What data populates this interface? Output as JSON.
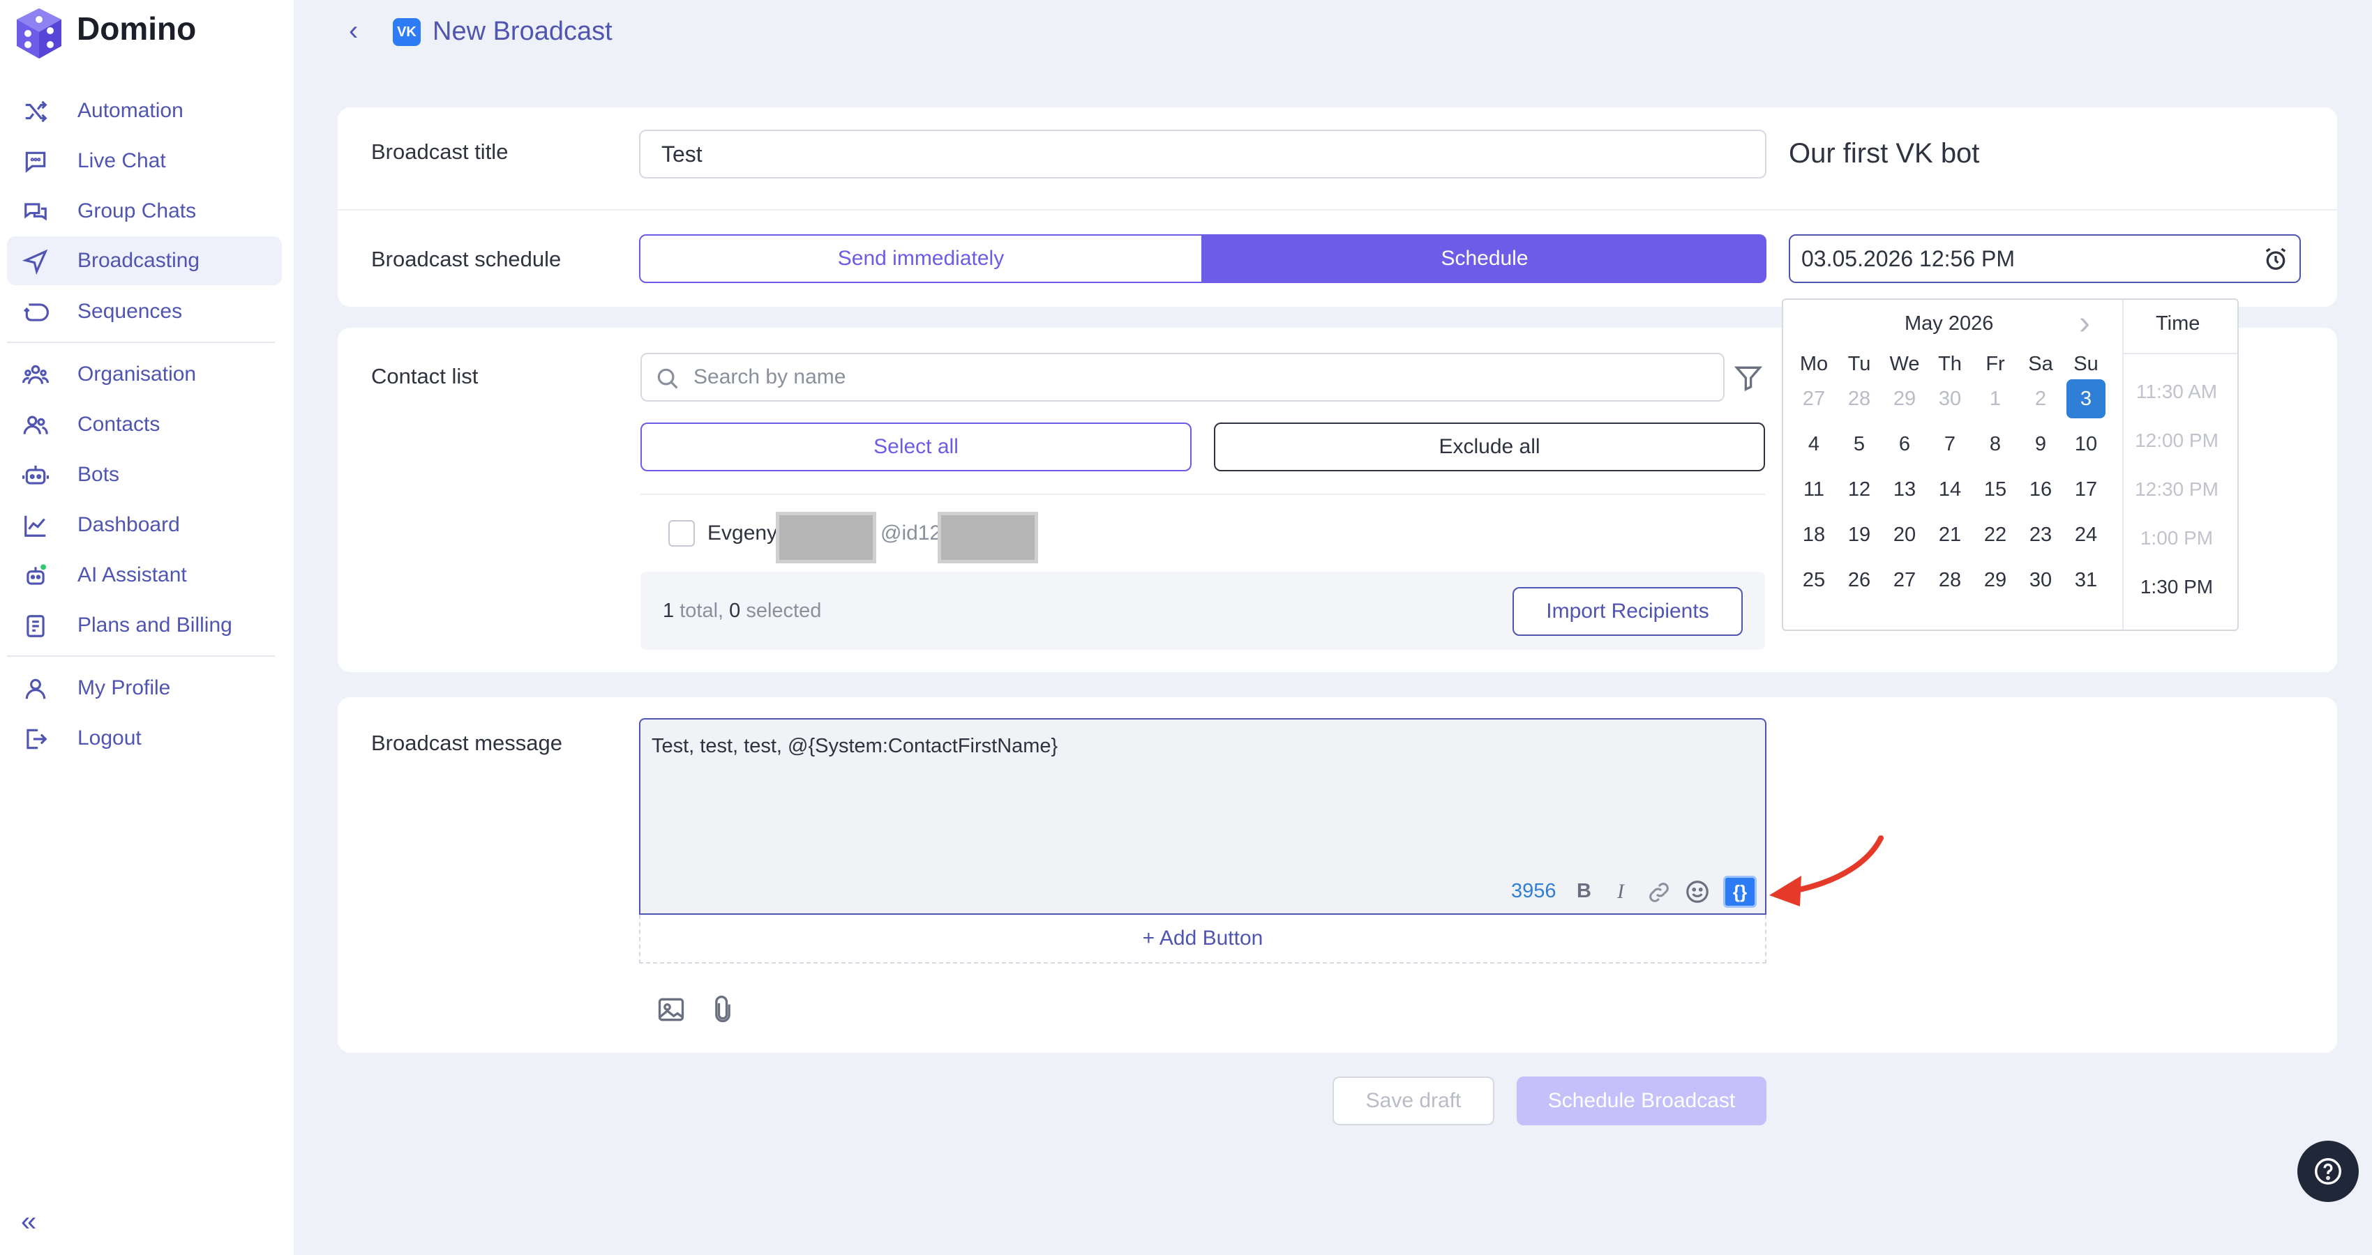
{
  "app": {
    "name": "Domino"
  },
  "sidebar": {
    "items": [
      {
        "label": "Automation",
        "icon": "shuffle-icon"
      },
      {
        "label": "Live Chat",
        "icon": "chat-bubble-icon"
      },
      {
        "label": "Group Chats",
        "icon": "group-chat-icon"
      },
      {
        "label": "Broadcasting",
        "icon": "send-icon",
        "active": true
      },
      {
        "label": "Sequences",
        "icon": "loop-icon"
      },
      {
        "label": "Organisation",
        "icon": "organisation-icon"
      },
      {
        "label": "Contacts",
        "icon": "contacts-icon"
      },
      {
        "label": "Bots",
        "icon": "bot-icon"
      },
      {
        "label": "Dashboard",
        "icon": "chart-icon"
      },
      {
        "label": "AI Assistant",
        "icon": "ai-assistant-icon"
      },
      {
        "label": "Plans and Billing",
        "icon": "billing-icon"
      },
      {
        "label": "My Profile",
        "icon": "user-icon"
      },
      {
        "label": "Logout",
        "icon": "logout-icon"
      }
    ],
    "collapse": "«"
  },
  "header": {
    "back": "‹",
    "vk_badge": "VK",
    "title": "New Broadcast"
  },
  "form": {
    "title_label": "Broadcast title",
    "title_value": "Test",
    "bot_name": "Our first VK bot",
    "schedule_label": "Broadcast schedule",
    "send_immediately": "Send immediately",
    "schedule": "Schedule",
    "datetime_value": "03.05.2026 12:56 PM",
    "contact_label": "Contact list",
    "search_placeholder": "Search by name",
    "select_all": "Select all",
    "exclude_all": "Exclude all",
    "contact_name": "Evgeny",
    "contact_handle": "@id12",
    "total_count": "1",
    "total_text": " total, ",
    "selected_count": "0",
    "selected_text": " selected",
    "import": "Import Recipients",
    "message_label": "Broadcast message",
    "message_value": "Test, test, test, @{System:ContactFirstName}",
    "char_count": "3956",
    "bold": "B",
    "italic": "I",
    "variables": "{}",
    "add_button": "+ Add Button",
    "save_draft": "Save draft",
    "schedule_broadcast": "Schedule Broadcast"
  },
  "calendar": {
    "month": "May 2026",
    "time_header": "Time",
    "weekdays": [
      "Mo",
      "Tu",
      "We",
      "Th",
      "Fr",
      "Sa",
      "Su"
    ],
    "days": [
      [
        "27",
        "28",
        "29",
        "30",
        "1",
        "2",
        "3"
      ],
      [
        "4",
        "5",
        "6",
        "7",
        "8",
        "9",
        "10"
      ],
      [
        "11",
        "12",
        "13",
        "14",
        "15",
        "16",
        "17"
      ],
      [
        "18",
        "19",
        "20",
        "21",
        "22",
        "23",
        "24"
      ],
      [
        "25",
        "26",
        "27",
        "28",
        "29",
        "30",
        "31"
      ]
    ],
    "selected_day": "3",
    "times": [
      "11:30 AM",
      "12:00 PM",
      "12:30 PM",
      "1:00 PM",
      "1:30 PM"
    ],
    "next": "›"
  },
  "colors": {
    "accent": "#6c5ce7",
    "brand": "#4f55b0",
    "selected_day": "#2f7fd6",
    "arrow": "#e53a2a"
  }
}
